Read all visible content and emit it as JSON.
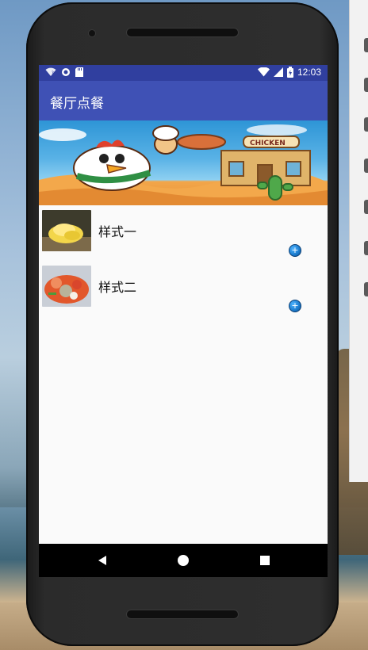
{
  "colors": {
    "status_bar": "#303f9f",
    "app_bar": "#3f51b5",
    "screen_bg": "#fafafa",
    "nav_bar": "#000000",
    "add_button": "#1e7fd1"
  },
  "status_bar": {
    "time": "12:03",
    "left_icons": [
      "wifi-question-icon",
      "sync-icon",
      "sdcard-icon"
    ],
    "right_icons": [
      "wifi-icon",
      "signal-icon",
      "battery-charging-icon"
    ]
  },
  "app_bar": {
    "title": "餐厅点餐"
  },
  "banner": {
    "sign_text": "CHICKEN"
  },
  "menu": {
    "items": [
      {
        "label": "样式一",
        "image": "food-thumbnail-1",
        "add_icon": "+"
      },
      {
        "label": "样式二",
        "image": "food-thumbnail-2",
        "add_icon": "+"
      }
    ]
  },
  "nav_bar": {
    "buttons": [
      "back-button",
      "home-button",
      "recents-button"
    ]
  }
}
